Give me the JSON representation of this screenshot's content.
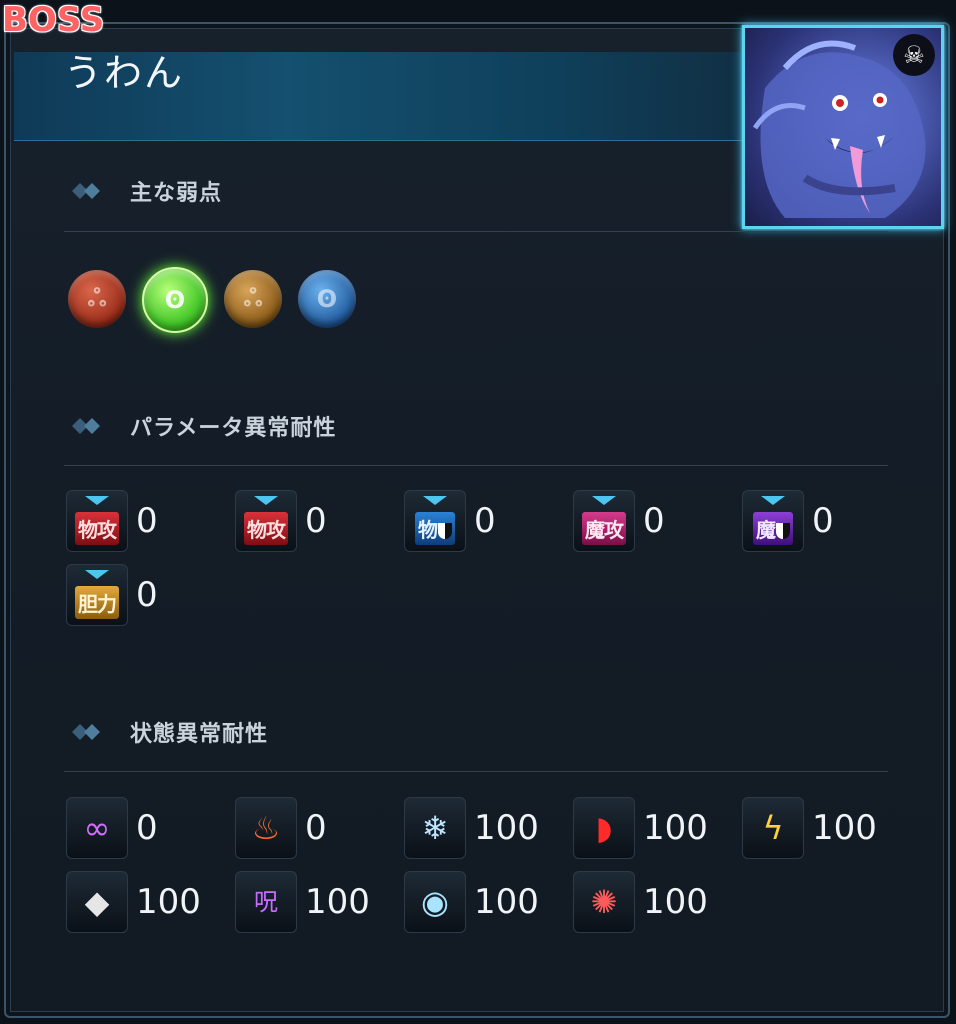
{
  "badge": "BOSS",
  "boss": {
    "name": "うわん"
  },
  "sections": {
    "weakness": {
      "title": "主な弱点",
      "icons": [
        {
          "element": "fire",
          "icon": "fire-element-orb-icon",
          "glyph": "ஃ",
          "highlighted": false
        },
        {
          "element": "wind",
          "icon": "wind-element-orb-icon",
          "glyph": "ʘ",
          "highlighted": true
        },
        {
          "element": "earth",
          "icon": "earth-element-orb-icon",
          "glyph": "ஃ",
          "highlighted": false
        },
        {
          "element": "water",
          "icon": "water-element-orb-icon",
          "glyph": "ʘ",
          "highlighted": false
        }
      ]
    },
    "param": {
      "title": "パラメータ異常耐性",
      "items": [
        {
          "icon": "phys-atk-down-icon",
          "label": "物攻",
          "color": "red",
          "value": "0"
        },
        {
          "icon": "phys-atk-down-icon",
          "label": "物攻",
          "color": "red",
          "value": "0"
        },
        {
          "icon": "phys-def-down-icon",
          "label": "物",
          "color": "blue",
          "shield": true,
          "value": "0"
        },
        {
          "icon": "mag-atk-down-icon",
          "label": "魔攻",
          "color": "pink",
          "value": "0"
        },
        {
          "icon": "mag-def-down-icon",
          "label": "魔",
          "color": "purple",
          "shield": true,
          "value": "0"
        },
        {
          "icon": "courage-down-icon",
          "label": "胆力",
          "color": "gold",
          "value": "0"
        }
      ]
    },
    "status": {
      "title": "状態異常耐性",
      "items": [
        {
          "icon": "charm-status-icon",
          "glyph": "∞",
          "color": "#d26cff",
          "value": "0"
        },
        {
          "icon": "burn-status-icon",
          "glyph": "♨",
          "color": "#ff6a2e",
          "value": "0"
        },
        {
          "icon": "freeze-status-icon",
          "glyph": "❄",
          "color": "#bfe6ff",
          "value": "100"
        },
        {
          "icon": "bleed-status-icon",
          "glyph": "◗",
          "color": "#ff2a2a",
          "value": "100"
        },
        {
          "icon": "paralysis-status-icon",
          "glyph": "ϟ",
          "color": "#ffd23b",
          "value": "100"
        },
        {
          "icon": "petrify-status-icon",
          "glyph": "◆",
          "color": "#e6e6e6",
          "value": "100"
        },
        {
          "icon": "curse-status-icon",
          "glyph": "呪",
          "color": "#c86bff",
          "value": "100"
        },
        {
          "icon": "blind-status-icon",
          "glyph": "◉",
          "color": "#a8e4ff",
          "value": "100"
        },
        {
          "icon": "confuse-status-icon",
          "glyph": "✺",
          "color": "#ff5a5a",
          "value": "100"
        }
      ]
    }
  }
}
